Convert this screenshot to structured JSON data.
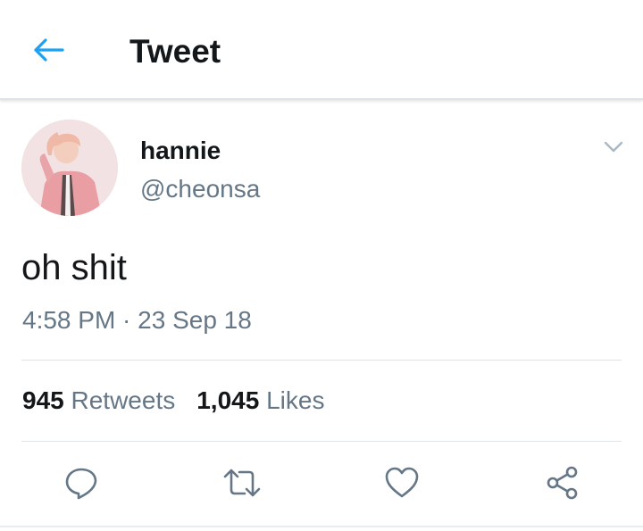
{
  "header": {
    "title": "Tweet",
    "back_icon": "back-arrow-icon",
    "accent_color": "#1da1f2"
  },
  "tweet": {
    "display_name": "hannie",
    "handle": "@cheonsa",
    "text": "oh shit",
    "timestamp": "4:58 PM · 23 Sep 18",
    "stats": {
      "retweets_count": "945",
      "retweets_label": "Retweets",
      "likes_count": "1,045",
      "likes_label": "Likes"
    }
  },
  "actions": [
    {
      "name": "reply",
      "icon": "reply-icon"
    },
    {
      "name": "retweet",
      "icon": "retweet-icon"
    },
    {
      "name": "like",
      "icon": "heart-icon"
    },
    {
      "name": "share",
      "icon": "share-icon"
    }
  ],
  "colors": {
    "text_primary": "#14171a",
    "text_secondary": "#657786",
    "icon_gray": "#657786",
    "divider": "#dfe3e6"
  }
}
